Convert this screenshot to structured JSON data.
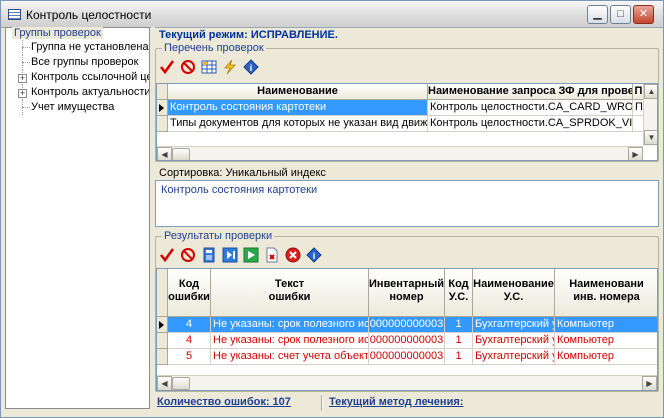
{
  "window": {
    "title": "Контроль целостности"
  },
  "left_panel": {
    "title": "Группы проверок",
    "items": [
      {
        "label": "Группа не установлена",
        "expandable": false
      },
      {
        "label": "Все группы проверок",
        "expandable": false
      },
      {
        "label": "Контроль ссылочной целос",
        "expandable": true
      },
      {
        "label": "Контроль актуальности да",
        "expandable": true
      },
      {
        "label": "Учет имущества",
        "expandable": false
      }
    ]
  },
  "mode_label": "Текущий режим: ИСПРАВЛЕНИЕ.",
  "checks": {
    "title": "Перечень проверок",
    "toolbar_icons": [
      "checkmark-icon",
      "no-entry-icon",
      "grid-table-icon",
      "lightning-icon",
      "info-icon"
    ],
    "columns": [
      "Наименование",
      "Наименование запроса ЗФ для проверки",
      "П"
    ],
    "rows": [
      {
        "name": "Контроль состояния картотеки",
        "query": "Контроль целостности.CA_CARD_WRONG",
        "extra": "П",
        "selected": true
      },
      {
        "name": "Типы документов для которых не указан вид движения",
        "query": "Контроль целостности.CA_SPRDOK_VIDDV",
        "extra": "",
        "selected": false
      }
    ]
  },
  "sort": {
    "label": "Сортировка: Уникальный индекс",
    "value": "Контроль состояния картотеки"
  },
  "results": {
    "title": "Результаты проверки",
    "toolbar_icons": [
      "checkmark-icon",
      "no-entry-icon",
      "form-icon",
      "skip-icon",
      "play-icon",
      "document-delete-icon",
      "delete-icon",
      "info-icon"
    ],
    "columns": [
      {
        "l1": "Код",
        "l2": "ошибки"
      },
      {
        "l1": "Текст",
        "l2": "ошибки"
      },
      {
        "l1": "Инвентарный",
        "l2": "номер"
      },
      {
        "l1": "Код",
        "l2": "У.С."
      },
      {
        "l1": "Наименование",
        "l2": "У.С."
      },
      {
        "l1": "Наименовани",
        "l2": "инв. номера"
      }
    ],
    "rows": [
      {
        "code": "4",
        "text": "Не указаны: срок полезного исполь",
        "inv": "000000000003",
        "us_code": "1",
        "us_name": "Бухгалтерский уче",
        "inv_name": "Компьютер",
        "selected": true
      },
      {
        "code": "4",
        "text": "Не указаны: срок полезного исполь",
        "inv": "000000000003",
        "us_code": "1",
        "us_name": "Бухгалтерский уче",
        "inv_name": "Компьютер",
        "selected": false
      },
      {
        "code": "5",
        "text": "Не указаны: счет учета объекта ил",
        "inv": "000000000003",
        "us_code": "1",
        "us_name": "Бухгалтерский уче",
        "inv_name": "Компьютер",
        "selected": false
      }
    ]
  },
  "status": {
    "errors": "Количество ошибок: 107",
    "method": "Текущий метод лечения:"
  },
  "colors": {
    "selection": "#3399ff",
    "error_text": "#d40000",
    "label_blue": "#1f3f8f"
  }
}
